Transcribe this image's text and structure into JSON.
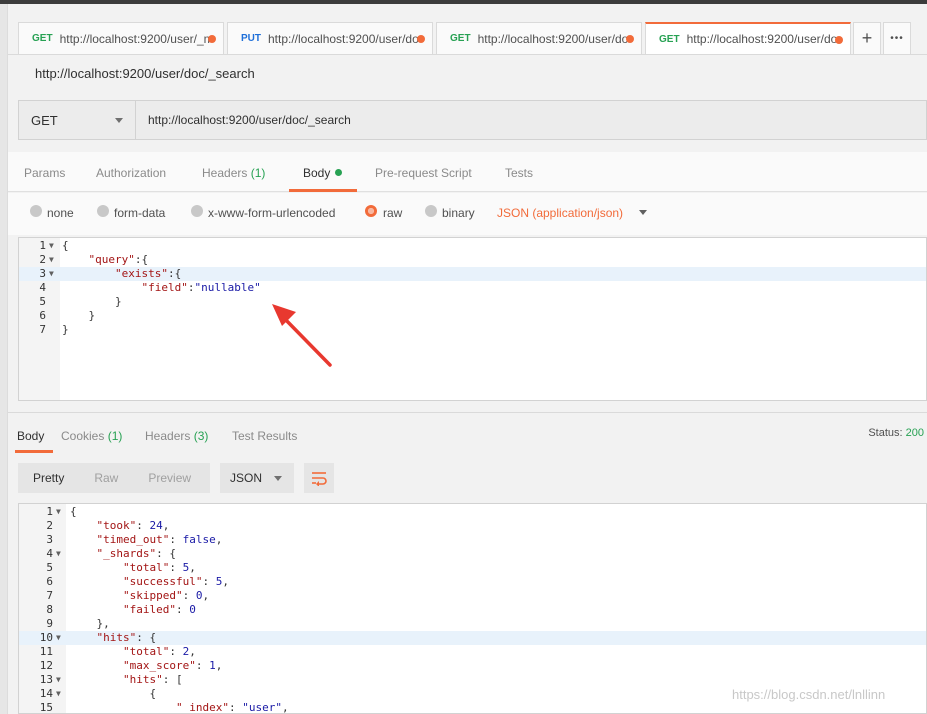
{
  "tabs": [
    {
      "method": "GET",
      "url": "http://localhost:9200/user/_m"
    },
    {
      "method": "PUT",
      "url": "http://localhost:9200/user/do"
    },
    {
      "method": "GET",
      "url": "http://localhost:9200/user/do"
    },
    {
      "method": "GET",
      "url": "http://localhost:9200/user/do"
    }
  ],
  "tab_actions": {
    "add": "+",
    "more": "•••"
  },
  "request": {
    "title": "http://localhost:9200/user/doc/_search",
    "method": "GET",
    "url": "http://localhost:9200/user/doc/_search"
  },
  "request_tabs": {
    "params": "Params",
    "authorization": "Authorization",
    "headers": "Headers",
    "headers_count": "(1)",
    "body": "Body",
    "prerequest": "Pre-request Script",
    "tests": "Tests"
  },
  "body_options": {
    "none": "none",
    "form_data": "form-data",
    "urlencoded": "x-www-form-urlencoded",
    "raw": "raw",
    "binary": "binary",
    "content_type": "JSON (application/json)"
  },
  "request_body_lines": [
    {
      "n": "1",
      "fold": true,
      "text": "{"
    },
    {
      "n": "2",
      "fold": true,
      "text": "    \"query\":{"
    },
    {
      "n": "3",
      "fold": true,
      "text": "        \"exists\":{"
    },
    {
      "n": "4",
      "fold": false,
      "text": "            \"field\":\"nullable\""
    },
    {
      "n": "5",
      "fold": false,
      "text": "        }"
    },
    {
      "n": "6",
      "fold": false,
      "text": "    }"
    },
    {
      "n": "7",
      "fold": false,
      "text": "}"
    }
  ],
  "response_tabs": {
    "body": "Body",
    "cookies": "Cookies",
    "cookies_count": "(1)",
    "headers": "Headers",
    "headers_count": "(3)",
    "test_results": "Test Results"
  },
  "status": {
    "label": "Status:",
    "value": "200"
  },
  "view_modes": {
    "pretty": "Pretty",
    "raw": "Raw",
    "preview": "Preview",
    "format": "JSON"
  },
  "response_body_lines": [
    {
      "n": "1",
      "fold": true,
      "text": "{"
    },
    {
      "n": "2",
      "fold": false,
      "text": "    \"took\": 24,"
    },
    {
      "n": "3",
      "fold": false,
      "text": "    \"timed_out\": false,"
    },
    {
      "n": "4",
      "fold": true,
      "text": "    \"_shards\": {"
    },
    {
      "n": "5",
      "fold": false,
      "text": "        \"total\": 5,"
    },
    {
      "n": "6",
      "fold": false,
      "text": "        \"successful\": 5,"
    },
    {
      "n": "7",
      "fold": false,
      "text": "        \"skipped\": 0,"
    },
    {
      "n": "8",
      "fold": false,
      "text": "        \"failed\": 0"
    },
    {
      "n": "9",
      "fold": false,
      "text": "    },"
    },
    {
      "n": "10",
      "fold": true,
      "text": "    \"hits\": {"
    },
    {
      "n": "11",
      "fold": false,
      "text": "        \"total\": 2,"
    },
    {
      "n": "12",
      "fold": false,
      "text": "        \"max_score\": 1,"
    },
    {
      "n": "13",
      "fold": true,
      "text": "        \"hits\": ["
    },
    {
      "n": "14",
      "fold": true,
      "text": "            {"
    },
    {
      "n": "15",
      "fold": false,
      "text": "                \"_index\": \"user\","
    }
  ],
  "watermark": "https://blog.csdn.net/lnllinn",
  "colors": {
    "accent": "#f26b3a",
    "get": "#27a153",
    "put": "#1e6fd9",
    "status_ok": "#27a153"
  }
}
